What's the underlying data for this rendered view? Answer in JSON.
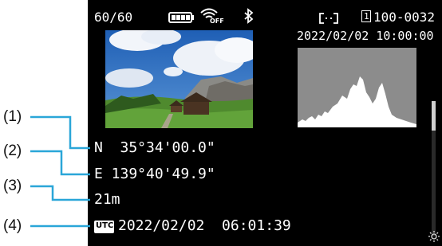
{
  "top_bar": {
    "shot_counter": "60/60",
    "battery_icon": "battery-full-icon",
    "wifi_icon": "wifi-off-icon",
    "wifi_state": "OFF",
    "bluetooth_icon": "bluetooth-icon",
    "af_icon": "af-frame-icon",
    "card_slot": "1",
    "folder_file": "100-0032"
  },
  "capture_datetime": "2022/02/02 10:00:00",
  "gps": {
    "latitude": "N  35°34'00.0\"",
    "longitude": "E 139°40'49.9\"",
    "altitude": "21m",
    "utc_icon": "UTC",
    "utc_datetime": "2022/02/02  06:01:39"
  },
  "callouts": [
    "(1)",
    "(2)",
    "(3)",
    "(4)"
  ],
  "colors": {
    "screen": "#000000",
    "text": "#ffffff",
    "histogram_bg": "#8c8c8c",
    "leader": "#2aa6d8"
  }
}
